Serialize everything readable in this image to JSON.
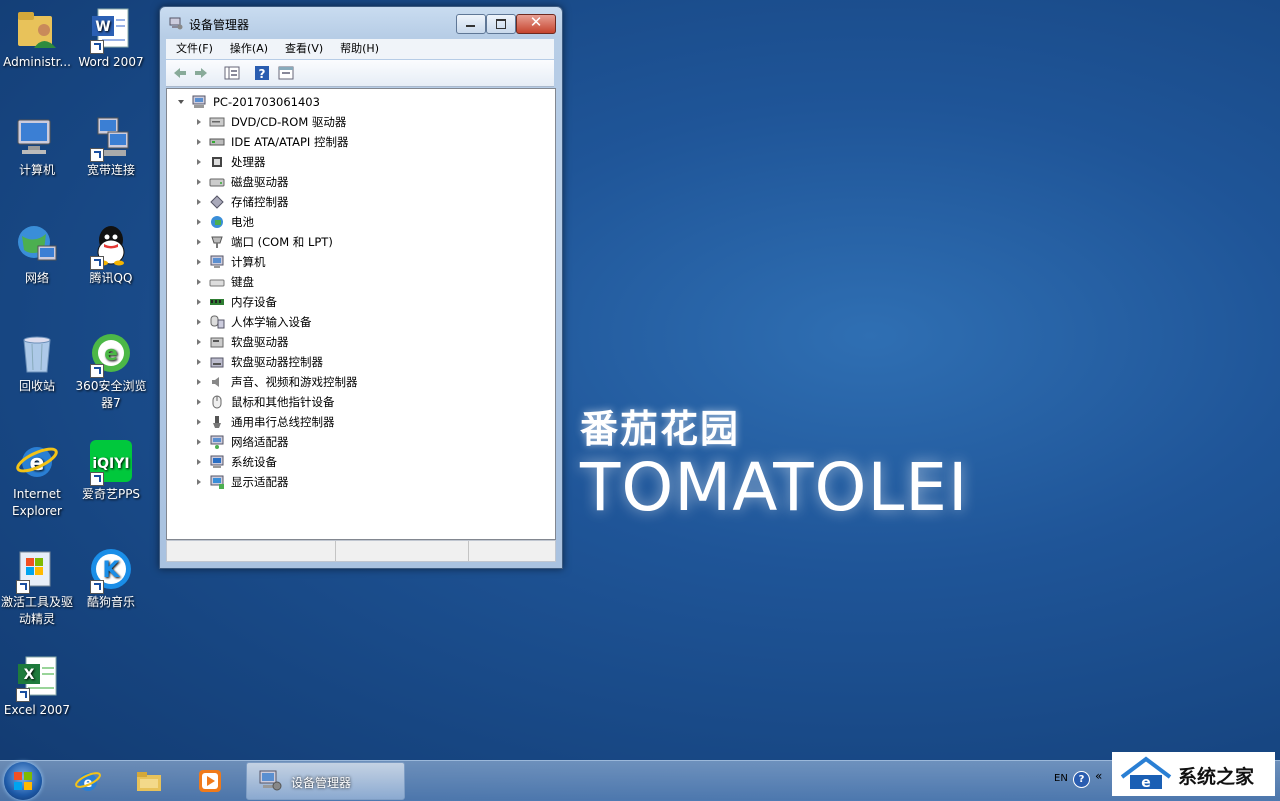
{
  "desktop": {
    "brand_cn": "番茄花园",
    "brand_en": "TOMATOLEI",
    "icons": [
      {
        "label": "Administr...",
        "icon": "user-folder-icon"
      },
      {
        "label": "Word 2007",
        "icon": "word-icon"
      },
      {
        "label": "计算机",
        "icon": "computer-icon"
      },
      {
        "label": "宽带连接",
        "icon": "broadband-icon"
      },
      {
        "label": "网络",
        "icon": "network-icon"
      },
      {
        "label": "腾讯QQ",
        "icon": "qq-icon"
      },
      {
        "label": "回收站",
        "icon": "recycle-bin-icon"
      },
      {
        "label": "360安全浏览器7",
        "icon": "360-browser-icon"
      },
      {
        "label": "Internet Explorer",
        "icon": "ie-icon"
      },
      {
        "label": "爱奇艺PPS",
        "icon": "iqiyi-icon"
      },
      {
        "label": "激活工具及驱动精灵",
        "icon": "activation-tool-icon"
      },
      {
        "label": "酷狗音乐",
        "icon": "kugou-icon"
      },
      {
        "label": "Excel 2007",
        "icon": "excel-icon"
      }
    ]
  },
  "window": {
    "title": "设备管理器",
    "menus": [
      "文件(F)",
      "操作(A)",
      "查看(V)",
      "帮助(H)"
    ],
    "tree": {
      "root": "PC-201703061403",
      "items": [
        {
          "label": "DVD/CD-ROM 驱动器",
          "icon": "dvd-drive-icon"
        },
        {
          "label": "IDE ATA/ATAPI 控制器",
          "icon": "ide-controller-icon"
        },
        {
          "label": "处理器",
          "icon": "processor-icon"
        },
        {
          "label": "磁盘驱动器",
          "icon": "disk-drive-icon"
        },
        {
          "label": "存储控制器",
          "icon": "storage-controller-icon"
        },
        {
          "label": "电池",
          "icon": "battery-icon"
        },
        {
          "label": "端口 (COM 和 LPT)",
          "icon": "port-icon"
        },
        {
          "label": "计算机",
          "icon": "computer-icon"
        },
        {
          "label": "键盘",
          "icon": "keyboard-icon"
        },
        {
          "label": "内存设备",
          "icon": "memory-icon"
        },
        {
          "label": "人体学输入设备",
          "icon": "hid-icon"
        },
        {
          "label": "软盘驱动器",
          "icon": "floppy-drive-icon"
        },
        {
          "label": "软盘驱动器控制器",
          "icon": "floppy-controller-icon"
        },
        {
          "label": "声音、视频和游戏控制器",
          "icon": "sound-icon"
        },
        {
          "label": "鼠标和其他指针设备",
          "icon": "mouse-icon"
        },
        {
          "label": "通用串行总线控制器",
          "icon": "usb-icon"
        },
        {
          "label": "网络适配器",
          "icon": "network-adapter-icon"
        },
        {
          "label": "系统设备",
          "icon": "system-device-icon"
        },
        {
          "label": "显示适配器",
          "icon": "display-adapter-icon"
        }
      ]
    }
  },
  "taskbar": {
    "active_task": "设备管理器",
    "tray_lang": "EN",
    "tray_help": "?",
    "tray_more": "«"
  },
  "watermark": {
    "text": "系统之家"
  }
}
